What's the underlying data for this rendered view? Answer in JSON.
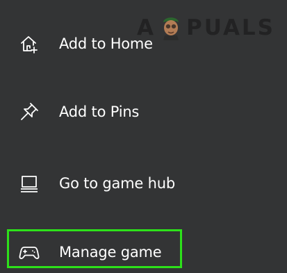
{
  "watermark": {
    "text_left": "A",
    "text_right": "PUALS"
  },
  "menu": {
    "items": [
      {
        "label": "Add to Home",
        "icon": "home-add-icon"
      },
      {
        "label": "Add to Pins",
        "icon": "pin-icon"
      },
      {
        "label": "Go to game hub",
        "icon": "game-hub-icon"
      },
      {
        "label": "Manage game",
        "icon": "controller-icon"
      }
    ],
    "focused_item": "Manage game"
  },
  "colors": {
    "background": "#333435",
    "text": "#ffffff",
    "focus_ring": "#2de11a"
  }
}
